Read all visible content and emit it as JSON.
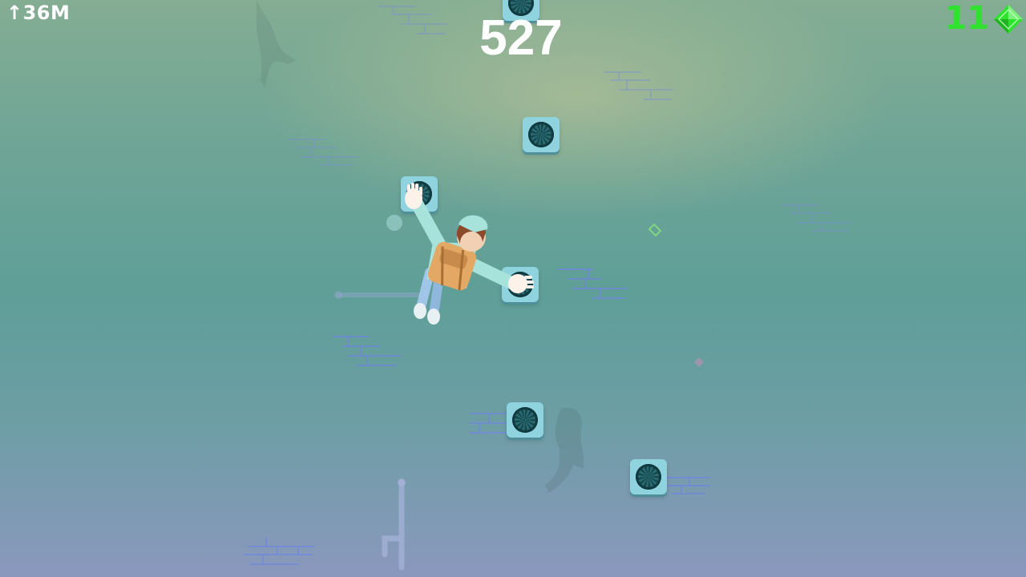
{
  "hud": {
    "height": "↑36M",
    "score": "527",
    "gems": "11"
  },
  "colors": {
    "gem": "#2ee22e",
    "hold": "#8fd3de",
    "hold_core": "#16494f",
    "brick_line": "#7a8fd6",
    "hud_text": "#ffffff"
  },
  "scene": {
    "holds": [
      "hold",
      "hold",
      "hold",
      "hold",
      "hold",
      "hold",
      "hold"
    ],
    "climber": "player-climber"
  }
}
